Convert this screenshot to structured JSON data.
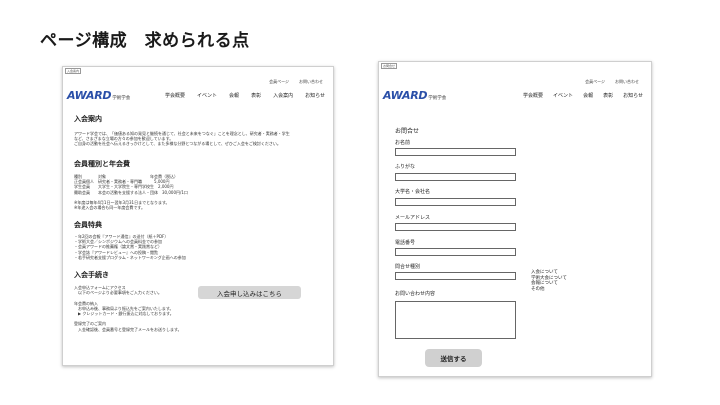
{
  "slide": {
    "title": "ページ構成　求められる点"
  },
  "left": {
    "tag": "入会案内",
    "util": [
      "会員ページ",
      "お問い合わせ"
    ],
    "logo_main": "AWARD",
    "logo_sub": "学術学会",
    "nav": [
      "学会概要",
      "イベント",
      "会報",
      "表彰",
      "入会案内",
      "お知らせ"
    ],
    "sections": [
      {
        "heading": "入会案内",
        "body": "アワード学会では、「価値ある知の発見と継続を通じて、社会と未来をつなぐ」ことを理念とし、研究者・実務者・学生\nなど、さまざまな立場の方々の参加を歓迎しています。\nご自身の活動を社会へ伝えるきっかけとして、また多様な分野とつながる場として、ぜひご入会をご検討ください。"
      },
      {
        "heading": "会員種別と年会費",
        "body": "種別　　　　対象　　　　　　　　　　　年会費（税込）\n正会員個人　研究者・実務者・専門職　　　5,000円\n学生会員　　大学生・大学院生・専門学校生　2,000円\n賛助会員　　本会の活動を支援する法人・団体　30,000円/1口\n\n※年度は毎年4月1日〜翌年3月31日までとなります。\n※年途入会の場合も同一年度会費です。"
      },
      {
        "heading": "会員特典",
        "body": "・年2回の会報『アワード通信』の送付（紙＋PDF）\n・学術大会／シンポジウムへの会員料金での参加\n・会員アワードの推薦権（論文賞・実践賞など）\n・学会誌『アワードレビュー』への投稿・閲覧\n・若手研究者支援プログラム・ネットワーキング企画への参加"
      },
      {
        "heading": "入会手続き",
        "body": "入会申込フォームにアクセス\n　以下のページより必要事項をご入力ください。\n\n年会費の納入\n　お申込み後、事務局より振込先をご案内いたします。\n　▶ クレジットカード・銀行振込に対応しております。\n\n登録完了のご案内\n　入金確認後、会員番号と登録完了メールをお送りします。"
      }
    ],
    "cta_label": "入会申し込みはこちら"
  },
  "right": {
    "tag": "お問合せ",
    "util": [
      "会員ページ",
      "お問い合わせ"
    ],
    "logo_main": "AWARD",
    "logo_sub": "学術学会",
    "nav": [
      "学会概要",
      "イベント",
      "会報",
      "表彰",
      "お知らせ"
    ],
    "form_title": "お問合せ",
    "fields": [
      "お名前",
      "ふりがな",
      "大学名・会社名",
      "メールアドレス",
      "電話番号",
      "問合せ種別"
    ],
    "textarea_label": "お問い合わせ内容",
    "dropdown_options": [
      "入会について",
      "学術大会について",
      "会報について",
      "その他"
    ],
    "submit_label": "送信する"
  }
}
